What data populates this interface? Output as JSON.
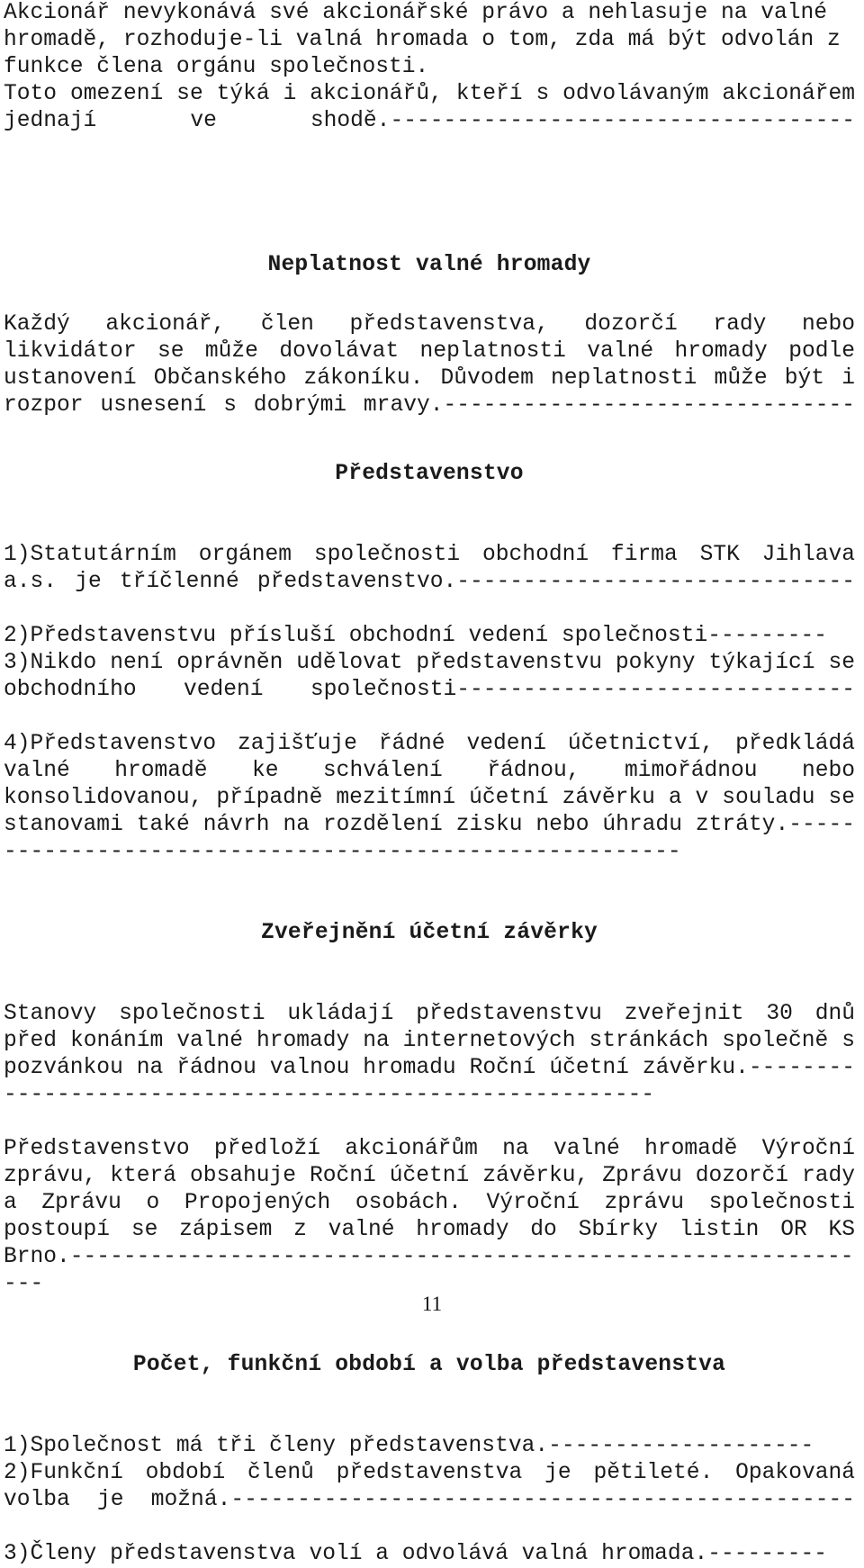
{
  "document": {
    "page_number": "11",
    "language": "cs",
    "blocks": [
      {
        "id": "intro-paragraph",
        "type": "paragraph",
        "text": "Akcionář nevykonává své akcionářské právo a nehlasuje na valné hromadě, rozhoduje-li valná hromada o tom, zda má být odvolán z funkce člena orgánu společnosti."
      },
      {
        "id": "intro-paragraph-2",
        "type": "paragraph",
        "text": "Toto omezení se týká i akcionářů, kteří s odvolávaným akcionářem jednají ve shodě.-----------------------------------"
      },
      {
        "id": "heading-neplatnost",
        "type": "heading",
        "text": "Neplatnost valné hromady"
      },
      {
        "id": "neplatnost-paragraph",
        "type": "paragraph",
        "text": "Každý akcionář, člen představenstva, dozorčí rady nebo likvidátor se může dovolávat neplatnosti valné hromady podle ustanovení Občanského zákoníku. Důvodem neplatnosti může být i rozpor usnesení s dobrými mravy.-------------------------------"
      },
      {
        "id": "heading-predstavenstvo",
        "type": "heading",
        "text": "Představenstvo"
      },
      {
        "id": "predstavenstvo-item-1",
        "type": "paragraph",
        "text": "1)Statutárním orgánem společnosti obchodní firma STK Jihlava a.s. je tříčlenné představenstvo.------------------------------"
      },
      {
        "id": "predstavenstvo-item-2",
        "type": "paragraph",
        "text": "2)Představenstvu přísluší obchodní vedení společnosti---------"
      },
      {
        "id": "predstavenstvo-item-3",
        "type": "paragraph",
        "text": "3)Nikdo není oprávněn udělovat představenstvu pokyny týkající se obchodního vedení společnosti------------------------------"
      },
      {
        "id": "predstavenstvo-item-4",
        "type": "paragraph",
        "text": "4)Představenstvo zajišťuje řádné vedení účetnictví, předkládá valné hromadě ke schválení řádnou, mimořádnou nebo konsolidovanou, případně mezitímní účetní závěrku a v souladu se stanovami také návrh na rozdělení zisku nebo úhradu ztráty.--------------------------------------------------------"
      },
      {
        "id": "heading-zverejneni",
        "type": "heading",
        "text": "Zveřejnění účetní závěrky"
      },
      {
        "id": "zverejneni-paragraph-1",
        "type": "paragraph",
        "text": "Stanovy společnosti ukládají představenstvu zveřejnit 30 dnů před konáním valné hromady  na internetových stránkách společně s pozvánkou na řádnou valnou hromadu Roční účetní závěrku.---------------------------------------------------------"
      },
      {
        "id": "zverejneni-paragraph-2",
        "type": "paragraph",
        "text": "Představenstvo předloží akcionářům na valné hromadě Výroční zprávu, která obsahuje Roční účetní závěrku, Zprávu dozorčí rady a Zprávu o Propojených osobách. Výroční zprávu společnosti postoupí se zápisem z valné hromady do Sbírky listin OR KS Brno.--------------------------------------------------------------"
      },
      {
        "id": "heading-pocet-funkcni-obdobi",
        "type": "heading",
        "text": "Počet, funkční období a volba představenstva"
      },
      {
        "id": "pocet-item-1",
        "type": "paragraph",
        "text": "1)Společnost má tři členy představenstva.--------------------"
      },
      {
        "id": "pocet-item-2",
        "type": "paragraph",
        "text": "2)Funkční období členů představenstva je pětileté. Opakovaná volba je možná.-----------------------------------------------"
      },
      {
        "id": "pocet-item-3",
        "type": "paragraph",
        "text": "3)Členy představenstva volí a odvolává valná hromada.---------"
      }
    ]
  }
}
